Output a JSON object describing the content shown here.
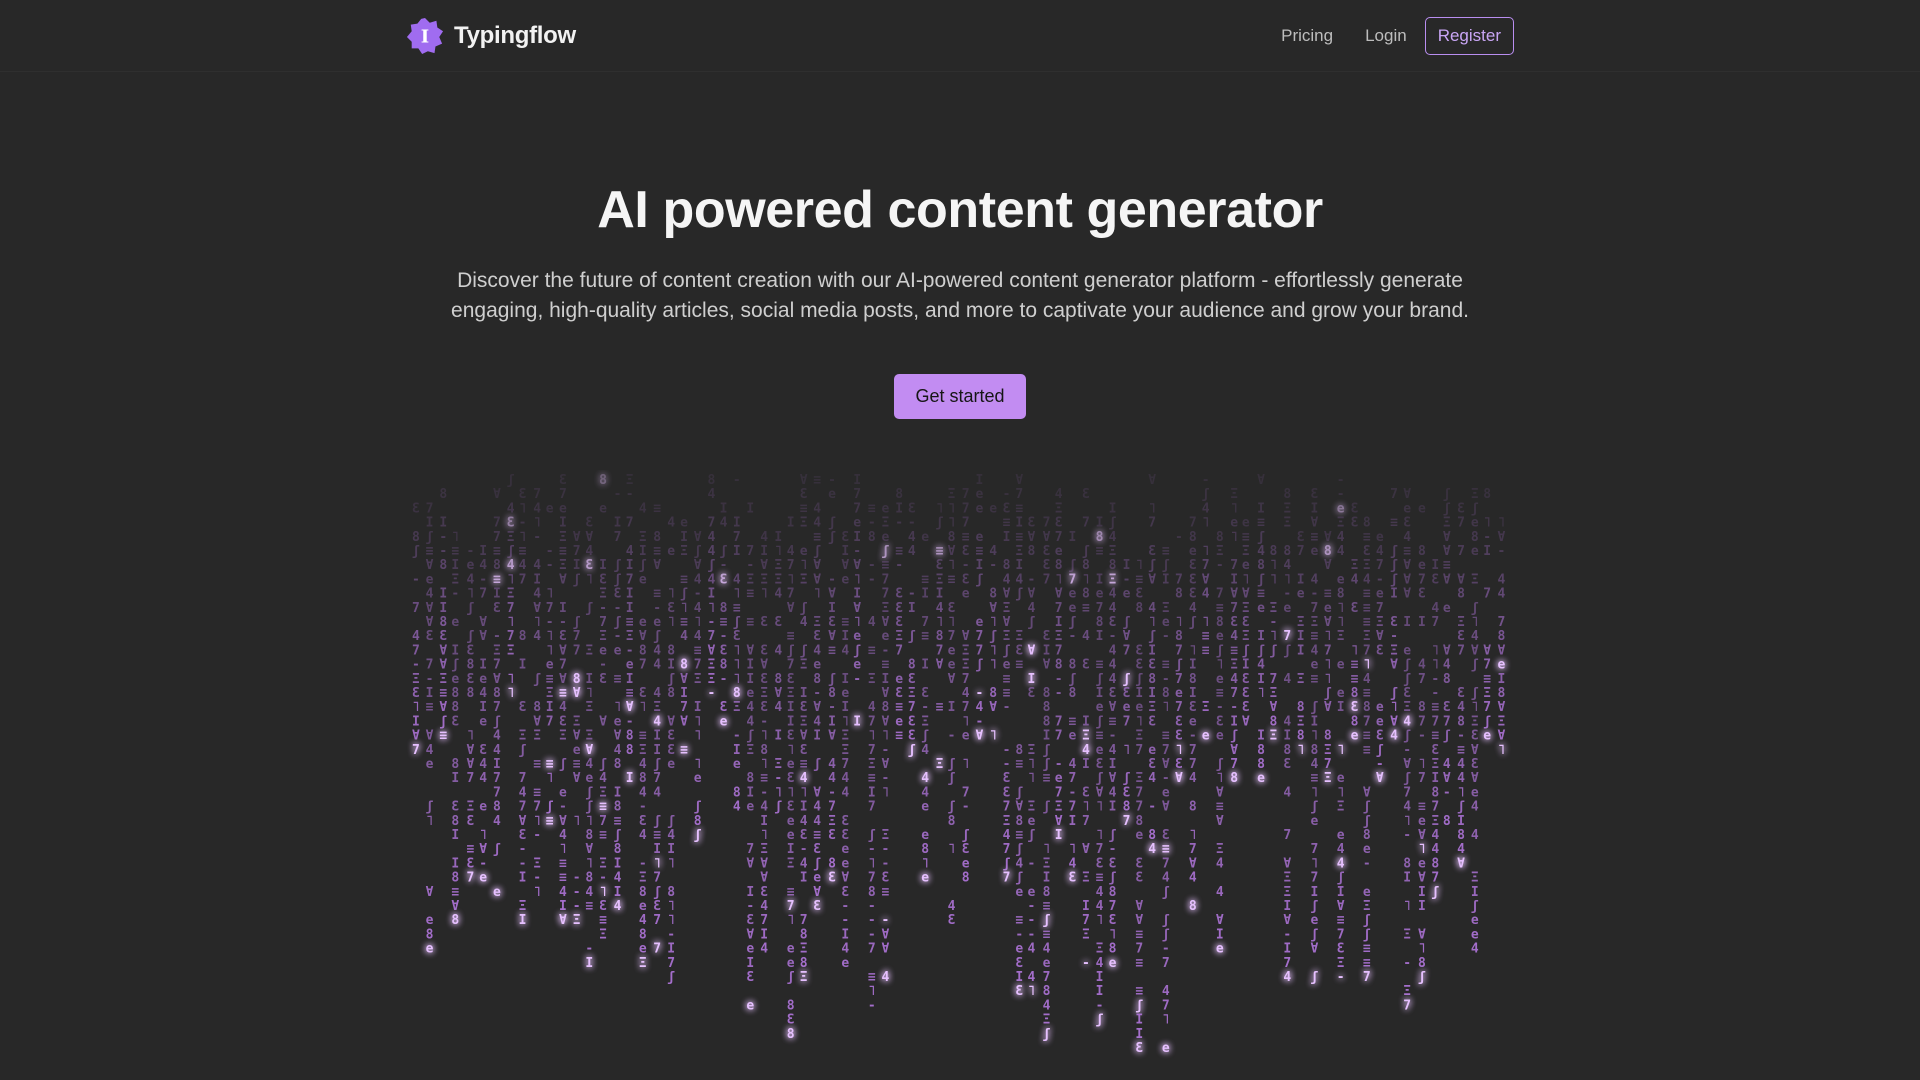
{
  "brand": {
    "name": "Typingflow",
    "logo_icon": "badge-i-icon",
    "logo_color": "#a06cf0"
  },
  "nav": {
    "pricing": "Pricing",
    "login": "Login",
    "register": "Register"
  },
  "hero": {
    "title": "AI powered content generator",
    "subtitle": "Discover the future of content creation with our AI-powered content generator platform - effortlessly generate engaging, high-quality articles, social media posts, and more to captivate your audience and grow your brand.",
    "cta": "Get started"
  },
  "matrix": {
    "glyphs": [
      "I",
      "4",
      "7",
      "e",
      "8",
      "≡",
      "Ɛ",
      "ʃ",
      "-",
      "˥",
      "Ɐ",
      "Ξ"
    ],
    "color": "#c07ef0",
    "glow_color": "#e6c0ff"
  },
  "colors": {
    "background": "#282828",
    "accent": "#c28cf2",
    "accent_border": "#b98ef0"
  }
}
